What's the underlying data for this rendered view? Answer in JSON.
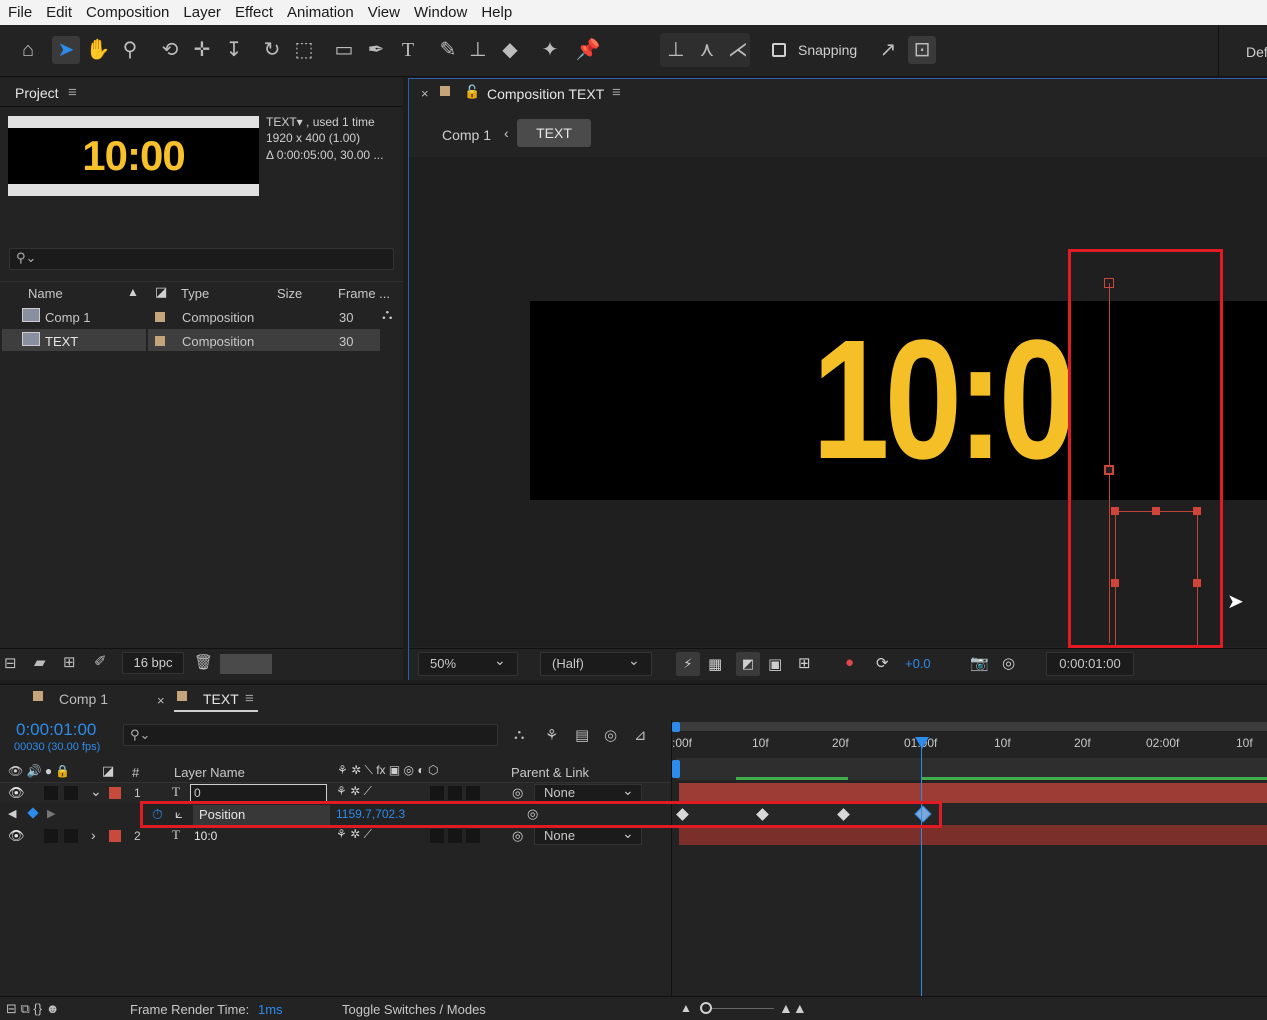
{
  "menu": [
    "File",
    "Edit",
    "Composition",
    "Layer",
    "Effect",
    "Animation",
    "View",
    "Window",
    "Help"
  ],
  "toolbar": {
    "snapping_label": "Snapping",
    "workspace_label": "Def"
  },
  "project": {
    "tab_label": "Project",
    "thumb_text": "10:00",
    "item_name": "TEXT▾ , used 1 time",
    "item_size": "1920 x 400 (1.00)",
    "item_duration": "Δ 0:00:05:00, 30.00 ...",
    "columns": {
      "name": "Name",
      "type": "Type",
      "size": "Size",
      "frame": "Frame ..."
    },
    "rows": [
      {
        "name": "Comp 1",
        "type": "Composition",
        "frame": "30"
      },
      {
        "name": "TEXT",
        "type": "Composition",
        "frame": "30"
      }
    ],
    "bpc": "16 bpc"
  },
  "comp": {
    "tab_label": "Composition TEXT",
    "breadcrumb_parent": "Comp 1",
    "breadcrumb_current": "TEXT",
    "display_text": "10:0",
    "zoom": "50%",
    "resolution": "(Half)",
    "exposure": "+0.0",
    "timecode": "0:00:01:00"
  },
  "timeline": {
    "tab_comp1": "Comp 1",
    "tab_text": "TEXT",
    "timecode": "0:00:01:00",
    "frames": "00030 (30.00 fps)",
    "col_num": "#",
    "col_layer": "Layer Name",
    "col_parent": "Parent & Link",
    "ruler": [
      ":00f",
      "10f",
      "20f",
      "01:00f",
      "10f",
      "20f",
      "02:00f",
      "10f"
    ],
    "layers": [
      {
        "num": "1",
        "name": "0",
        "parent": "None"
      },
      {
        "num": "2",
        "name": "10:0",
        "parent": "None"
      }
    ],
    "property_name": "Position",
    "property_value": "1159.7,702.3",
    "render_label": "Frame Render Time:",
    "render_value": "1ms",
    "toggle_label": "Toggle Switches / Modes"
  },
  "colors": {
    "accent": "#2d8ceb",
    "text_yellow": "#f5bf28",
    "highlight_red": "#e01b24"
  }
}
